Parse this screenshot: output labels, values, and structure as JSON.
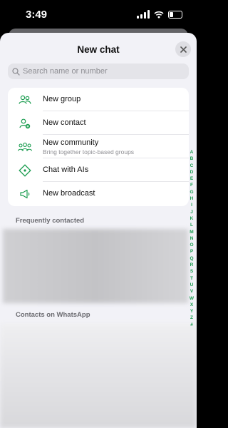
{
  "status_bar": {
    "time": "3:49"
  },
  "sheet": {
    "title": "New chat"
  },
  "search": {
    "placeholder": "Search name or number"
  },
  "menu": {
    "items": [
      {
        "label": "New group",
        "icon": "group-icon"
      },
      {
        "label": "New contact",
        "icon": "add-contact-icon"
      },
      {
        "label": "New community",
        "subtitle": "Bring together topic-based groups",
        "icon": "community-icon"
      },
      {
        "label": "Chat with AIs",
        "icon": "ai-icon"
      },
      {
        "label": "New broadcast",
        "icon": "broadcast-icon"
      }
    ]
  },
  "sections": {
    "frequent": "Frequently contacted",
    "contacts": "Contacts on WhatsApp"
  },
  "alphabet_index": [
    "A",
    "B",
    "C",
    "D",
    "E",
    "F",
    "G",
    "H",
    "I",
    "J",
    "K",
    "L",
    "M",
    "N",
    "O",
    "P",
    "Q",
    "R",
    "S",
    "T",
    "U",
    "V",
    "W",
    "X",
    "Y",
    "Z",
    "#"
  ],
  "colors": {
    "accent": "#1a9c4f",
    "sheet_bg": "#f2f2f7"
  }
}
